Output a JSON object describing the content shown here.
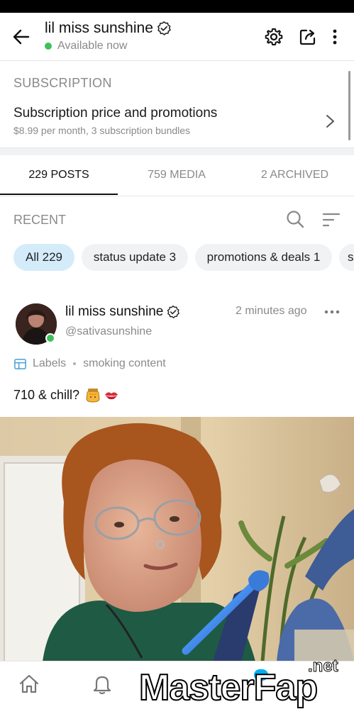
{
  "header": {
    "title": "lil miss sunshine",
    "status": "Available now",
    "icons": [
      "arrow-left-icon",
      "verified-badge-icon",
      "gear-icon",
      "share-icon",
      "more-vertical-icon"
    ]
  },
  "subscription": {
    "heading": "SUBSCRIPTION",
    "title": "Subscription price and promotions",
    "detail": "$8.99 per month, 3 subscription bundles"
  },
  "tabs": [
    {
      "label": "229 POSTS",
      "active": true
    },
    {
      "label": "759 MEDIA",
      "active": false
    },
    {
      "label": "2 ARCHIVED",
      "active": false
    }
  ],
  "recent": {
    "label": "RECENT"
  },
  "chips": [
    {
      "label": "All 229",
      "active": true
    },
    {
      "label": "status update 3",
      "active": false
    },
    {
      "label": "promotions & deals 1",
      "active": false
    },
    {
      "label": "s",
      "active": false
    }
  ],
  "post": {
    "name": "lil miss sunshine",
    "handle": "@sativasunshine",
    "time": "2 minutes ago",
    "labels_title": "Labels",
    "label_value": "smoking content",
    "caption": "710 & chill?"
  },
  "watermark": {
    "text": "MasterFap",
    "suffix": ".net"
  },
  "colors": {
    "accent": "#00aff0",
    "online": "#3ec15a",
    "chip_active": "#d4ebfa",
    "muted_text": "#8a8a8a"
  }
}
